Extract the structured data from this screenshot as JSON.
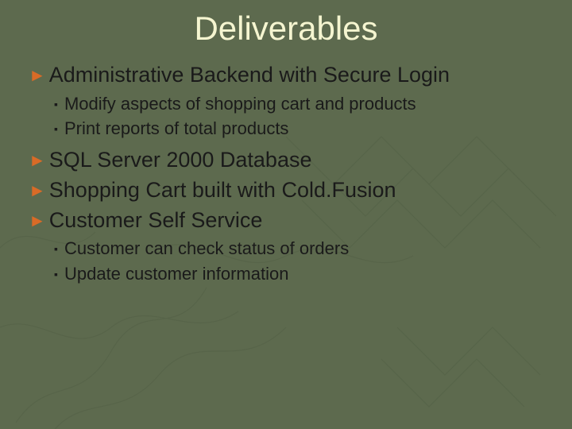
{
  "title": "Deliverables",
  "items": {
    "i1": {
      "label": "Administrative Backend with Secure Login",
      "subs": {
        "s1": "Modify aspects of shopping cart and products",
        "s2": "Print reports of total products"
      }
    },
    "i2": {
      "label": "SQL Server 2000 Database"
    },
    "i3": {
      "label": "Shopping Cart built with Cold.Fusion"
    },
    "i4": {
      "label": "Customer Self Service",
      "subs": {
        "s1": "Customer can check status of orders",
        "s2": "Update customer information"
      }
    }
  }
}
